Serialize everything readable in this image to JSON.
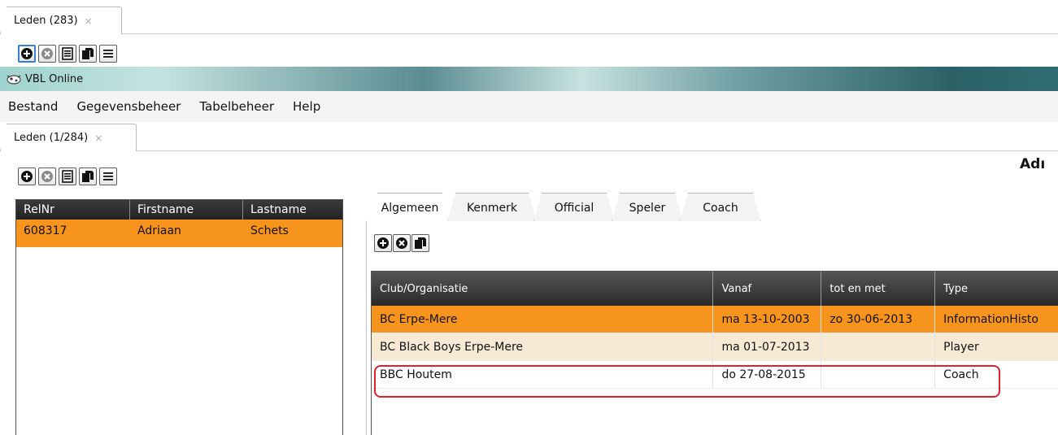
{
  "background_window": {
    "tab": {
      "label": "Leden (283)",
      "close": "×"
    }
  },
  "titlebar": {
    "title": "VBL Online"
  },
  "menubar": {
    "items": [
      "Bestand",
      "Gegevensbeheer",
      "Tabelbeheer",
      "Help"
    ]
  },
  "main_tab": {
    "label": "Leden (1/284)",
    "close": "×"
  },
  "header_name": "Adı",
  "members_table": {
    "columns": [
      "RelNr",
      "Firstname",
      "Lastname"
    ],
    "rows": [
      {
        "relnr": "608317",
        "firstname": "Adriaan",
        "lastname": "Schets"
      }
    ]
  },
  "detail_tabs": [
    "Algemeen",
    "Kenmerk",
    "Official",
    "Speler",
    "Coach"
  ],
  "clubs_table": {
    "columns": [
      "Club/Organisatie",
      "Vanaf",
      "tot en met",
      "Type"
    ],
    "rows": [
      {
        "club": "BC Erpe-Mere",
        "from": "ma 13-10-2003",
        "to": "zo 30-06-2013",
        "type": "InformationHisto"
      },
      {
        "club": "BC Black Boys Erpe-Mere",
        "from": "ma 01-07-2013",
        "to": "",
        "type": "Player"
      },
      {
        "club": "BBC Houtem",
        "from": "do 27-08-2015",
        "to": "",
        "type": "Coach"
      }
    ]
  },
  "colors": {
    "selected_row": "#f7941d",
    "alt_row": "#f7ead5",
    "header_dark": "#2a2a2a",
    "highlight_box": "#e0202a",
    "focus_border": "#3a7fd5"
  },
  "icons": [
    "add-icon",
    "remove-icon",
    "details-icon",
    "copy-icon",
    "list-icon"
  ]
}
